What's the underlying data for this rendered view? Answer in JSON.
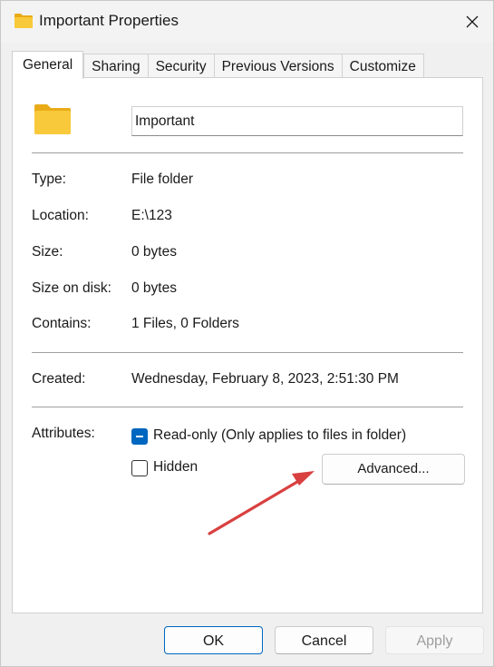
{
  "window": {
    "title": "Important Properties",
    "close_icon": "close-icon"
  },
  "tabs": [
    {
      "label": "General",
      "active": true
    },
    {
      "label": "Sharing",
      "active": false
    },
    {
      "label": "Security",
      "active": false
    },
    {
      "label": "Previous Versions",
      "active": false
    },
    {
      "label": "Customize",
      "active": false
    }
  ],
  "general": {
    "folder_icon": "folder-icon",
    "name_value": "Important",
    "properties": [
      {
        "label": "Type:",
        "value": "File folder"
      },
      {
        "label": "Location:",
        "value": "E:\\123"
      },
      {
        "label": "Size:",
        "value": "0 bytes"
      },
      {
        "label": "Size on disk:",
        "value": "0 bytes"
      },
      {
        "label": "Contains:",
        "value": "1 Files, 0 Folders"
      }
    ],
    "created": {
      "label": "Created:",
      "value": "Wednesday, February 8, 2023, 2:51:30 PM"
    },
    "attributes": {
      "label": "Attributes:",
      "readonly_label": "Read-only (Only applies to files in folder)",
      "readonly_state": "indeterminate",
      "hidden_label": "Hidden",
      "hidden_checked": false,
      "advanced_label": "Advanced..."
    }
  },
  "annotation": {
    "arrow_color": "#d94040"
  },
  "footer": {
    "ok_label": "OK",
    "cancel_label": "Cancel",
    "apply_label": "Apply",
    "apply_enabled": false
  },
  "colors": {
    "accent": "#0067c0",
    "folder_fill": "#f8c93a",
    "folder_back": "#e9ab17"
  }
}
